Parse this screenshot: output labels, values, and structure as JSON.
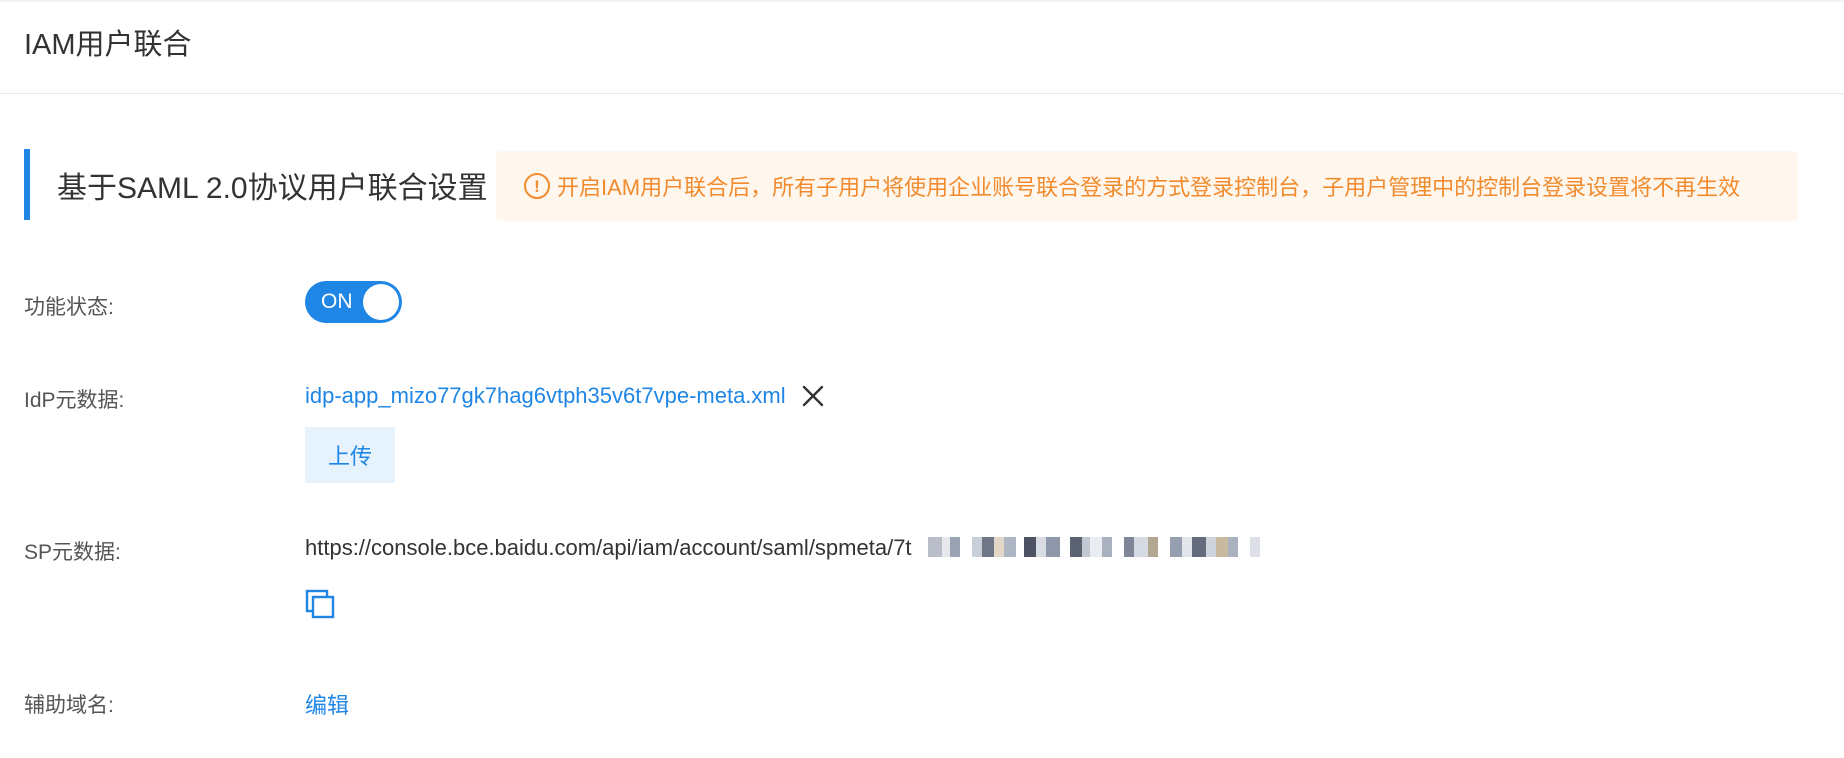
{
  "header": {
    "title": "IAM用户联合"
  },
  "section": {
    "title": "基于SAML 2.0协议用户联合设置",
    "notice": "开启IAM用户联合后，所有子用户将使用企业账号联合登录的方式登录控制台，子用户管理中的控制台登录设置将不再生效",
    "notice_icon": "exclamation-icon"
  },
  "rows": {
    "status": {
      "label": "功能状态:",
      "toggle_text": "ON",
      "toggle_on": true
    },
    "idp": {
      "label": "IdP元数据:",
      "file_name": "idp-app_mizo77gk7hag6vtph35v6t7vpe-meta.xml",
      "remove_icon": "close-icon",
      "upload_label": "上传"
    },
    "sp": {
      "label": "SP元数据:",
      "url_visible": "https://console.bce.baidu.com/api/iam/account/saml/spmeta/7t",
      "copy_icon": "copy-icon"
    },
    "domain": {
      "label": "辅助域名:",
      "edit_label": "编辑"
    }
  },
  "colors": {
    "accent": "#1f86e6",
    "warning": "#f18b2e",
    "warning_bg": "#fff7ee"
  }
}
